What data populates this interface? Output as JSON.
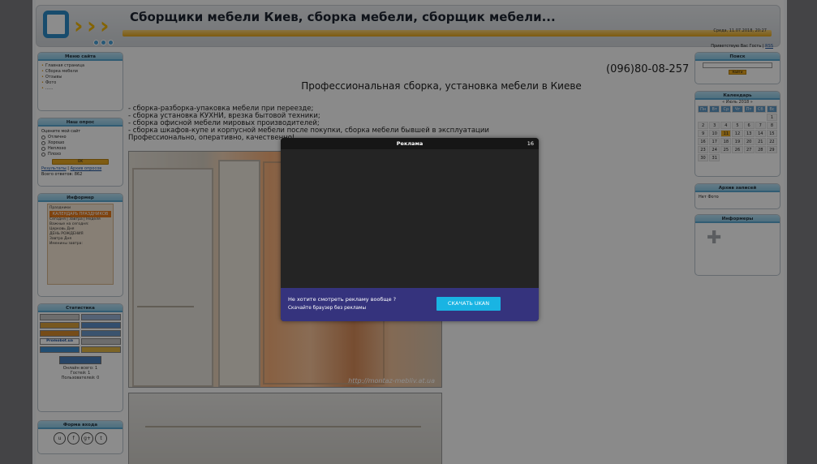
{
  "header": {
    "site_title": "Сборщики мебели Киев, сборка мебели, сборщик мебели...",
    "date_line": "Среда, 11.07.2018, 20:27",
    "greeting_prefix": "Приветствую Вас Гость",
    "greeting_link": "RSS"
  },
  "site_menu": {
    "title": "Меню сайта",
    "items": [
      "Главная страница",
      "Сборка мебели",
      "Отзывы",
      "Фото",
      "......"
    ]
  },
  "poll": {
    "title": "Наш опрос",
    "question": "Оцените мой сайт",
    "options": [
      "Отлично",
      "Хорошо",
      "Неплохо",
      "Плохо"
    ],
    "ok_label": "OK",
    "results_link": "Результаты",
    "archive_link": "Архив опросов",
    "total_label": "Всего ответов: 862"
  },
  "informer": {
    "title": "Информер",
    "head1": "Праздники",
    "head2": "КАЛЕНДАРЬ ПРАЗДНИКОВ",
    "lines": [
      "Сегодня | Завтра | Неделя",
      "Важные на сегодня:",
      "Церковь Дня",
      "ДЕНЬ РОЖДЕНИЯ",
      "Завтра Дня",
      "Именины завтра:"
    ]
  },
  "statistics": {
    "title": "Статистика",
    "counters": [
      "",
      "",
      "",
      "",
      "",
      "",
      "Promobot.ua",
      "",
      "",
      ""
    ],
    "online_lines": [
      "Онлайн всего: 1",
      "Гостей: 1",
      "Пользователей: 0"
    ]
  },
  "share": {
    "title": "Форма входа",
    "icons": [
      "u",
      "f",
      "g+",
      "t"
    ]
  },
  "main": {
    "phone": "(096)80-08-257",
    "title": "Профессиональная сборка, установка мебели в Киеве",
    "services": [
      "- сборка-разборка-упаковка мебели при переезде;",
      "- сборка установка КУХНИ, врезка бытовой техники;",
      "- сборка офисной мебели мировых производителей;",
      "- сборка шкафов-купе и корпусной мебели после покупки, сборка мебели бывшей в эксплуатации",
      "Профессионально, оперативно, качественно!"
    ],
    "watermark": "http://montaz-mebliv.at.ua"
  },
  "search": {
    "title": "Поиск",
    "button": "Найти"
  },
  "calendar": {
    "title": "Календарь",
    "month_label": "« Июль 2018 »",
    "dow": [
      "Пн",
      "Вт",
      "Ср",
      "Чт",
      "Пт",
      "Сб",
      "Вс"
    ],
    "weeks": [
      [
        "",
        "",
        "",
        "",
        "",
        "",
        "1"
      ],
      [
        "2",
        "3",
        "4",
        "5",
        "6",
        "7",
        "8"
      ],
      [
        "9",
        "10",
        "11",
        "12",
        "13",
        "14",
        "15"
      ],
      [
        "16",
        "17",
        "18",
        "19",
        "20",
        "21",
        "22"
      ],
      [
        "23",
        "24",
        "25",
        "26",
        "27",
        "28",
        "29"
      ],
      [
        "30",
        "31",
        "",
        "",
        "",
        "",
        ""
      ]
    ],
    "today": "11"
  },
  "archive": {
    "title": "Архив записей",
    "text": "Нет Фото"
  },
  "informers_right": {
    "title": "Информеры"
  },
  "ad_modal": {
    "title": "Реклама",
    "countdown": "16",
    "question": "Не хотите смотреть рекламу вообще ?",
    "subtitle": "Скачайте браузер без рекламы",
    "button": "СКАЧАТЬ UKAN"
  }
}
